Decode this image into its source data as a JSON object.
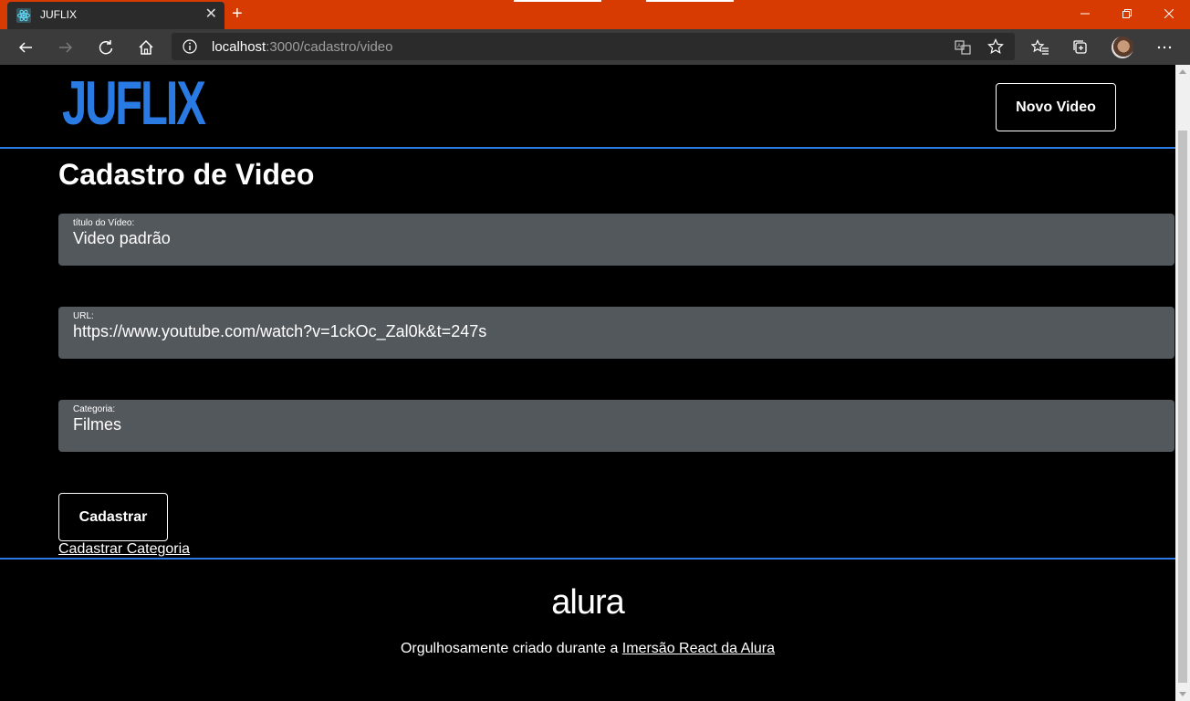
{
  "browser": {
    "tab_title": "JUFLIX",
    "address_host": "localhost",
    "address_path": ":3000/cadastro/video",
    "icons": [
      "react-favicon-icon",
      "close-icon",
      "plus-icon",
      "minimize-icon",
      "restore-icon",
      "close-window-icon",
      "back-icon",
      "forward-icon",
      "refresh-icon",
      "home-icon",
      "info-icon",
      "translate-icon",
      "star-icon",
      "favorites-icon",
      "collections-icon",
      "more-icon"
    ],
    "accent_color": "#d83b01"
  },
  "header": {
    "logo": "JUFLIX",
    "new_video_label": "Novo Video",
    "brand_color": "#2a7ae4"
  },
  "form": {
    "title": "Cadastro de Video",
    "fields": [
      {
        "label": "título do Vídeo:",
        "value": "Video padrão"
      },
      {
        "label": "URL:",
        "value": "https://www.youtube.com/watch?v=1ckOc_Zal0k&t=247s"
      },
      {
        "label": "Categoria:",
        "value": "Filmes"
      }
    ],
    "submit_label": "Cadastrar",
    "category_link": "Cadastrar Categoria"
  },
  "footer": {
    "brand": "alura",
    "text_prefix": "Orgulhosamente criado durante a ",
    "link_text": "Imersão React da Alura"
  }
}
